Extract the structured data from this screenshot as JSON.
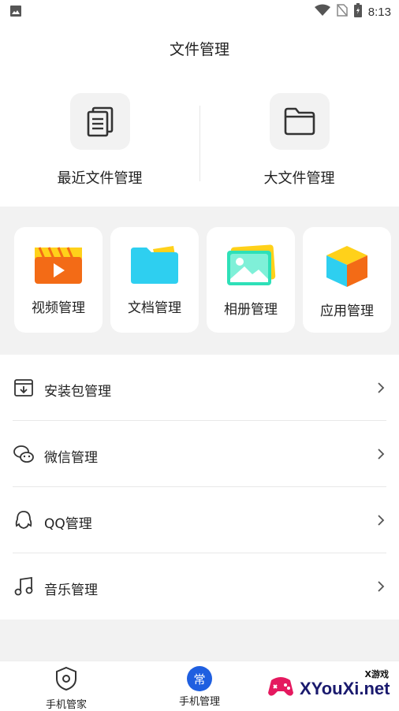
{
  "status_bar": {
    "time": "8:13"
  },
  "page_title": "文件管理",
  "top_tiles": [
    {
      "label": "最近文件管理",
      "icon": "recent-files-icon"
    },
    {
      "label": "大文件管理",
      "icon": "folder-icon"
    }
  ],
  "categories": [
    {
      "label": "视频管理",
      "icon": "video-icon"
    },
    {
      "label": "文档管理",
      "icon": "document-folder-icon"
    },
    {
      "label": "相册管理",
      "icon": "photo-album-icon"
    },
    {
      "label": "应用管理",
      "icon": "app-box-icon"
    }
  ],
  "list": [
    {
      "label": "安装包管理",
      "icon": "install-package-icon"
    },
    {
      "label": "微信管理",
      "icon": "wechat-icon"
    },
    {
      "label": "QQ管理",
      "icon": "qq-icon"
    },
    {
      "label": "音乐管理",
      "icon": "music-note-icon"
    }
  ],
  "bottom_nav": [
    {
      "label": "手机管家",
      "icon": "shield-icon"
    },
    {
      "label": "手机管理",
      "badge": "常",
      "active": true
    }
  ],
  "watermark": {
    "text": "XYouXi.net",
    "subtext": "X游戏"
  },
  "colors": {
    "active_blue": "#1f5fe0",
    "video_orange": "#f36b16",
    "doc_cyan": "#2ecff0",
    "yellow": "#ffd11a"
  }
}
